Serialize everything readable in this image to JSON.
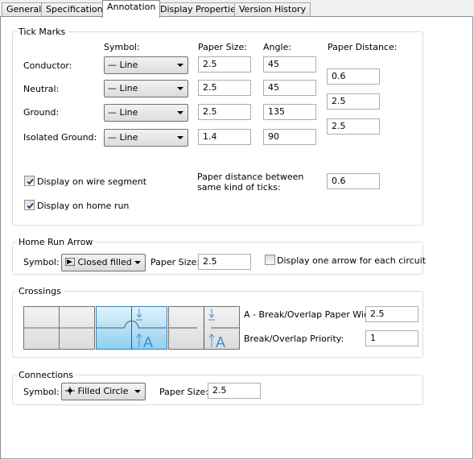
{
  "tabs": [
    "General",
    "Specifications",
    "Annotation",
    "Display Properties",
    "Version History"
  ],
  "tick_marks": {
    "title": "Tick Marks",
    "headers": {
      "symbol": "Symbol:",
      "paper_size": "Paper Size:",
      "angle": "Angle:",
      "paper_distance": "Paper Distance:"
    },
    "rows": [
      {
        "label": "Conductor:",
        "symbol": "Line",
        "paper_size": "2.5",
        "angle": "45"
      },
      {
        "label": "Neutral:",
        "symbol": "Line",
        "paper_size": "2.5",
        "angle": "45"
      },
      {
        "label": "Ground:",
        "symbol": "Line",
        "paper_size": "2.5",
        "angle": "135"
      },
      {
        "label": "Isolated Ground:",
        "symbol": "Line",
        "paper_size": "1.4",
        "angle": "90"
      }
    ],
    "paper_distances": [
      "0.6",
      "2.5",
      "2.5"
    ],
    "display_on_wire_segment": {
      "label": "Display on wire segment",
      "checked": true
    },
    "display_on_home_run": {
      "label": "Display on home run",
      "checked": true
    },
    "same_kind_label": "Paper distance between same kind of ticks:",
    "same_kind_value": "0.6"
  },
  "home_run_arrow": {
    "title": "Home Run Arrow",
    "symbol_label": "Symbol:",
    "symbol_value": "Closed filled",
    "paper_size_label": "Paper Size:",
    "paper_size_value": "2.5",
    "one_arrow_label": "Display one arrow for each circuit",
    "one_arrow_checked": false
  },
  "crossings": {
    "title": "Crossings",
    "selected_style": 2,
    "width_label": "A - Break/Overlap Paper Width:",
    "width_value": "2.5",
    "priority_label": "Break/Overlap Priority:",
    "priority_value": "1",
    "glyph_letter": "A"
  },
  "connections": {
    "title": "Connections",
    "symbol_label": "Symbol:",
    "symbol_value": "Filled Circle",
    "paper_size_label": "Paper Size:",
    "paper_size_value": "2.5"
  },
  "colors": {
    "selected_blue": "#8fd0ef",
    "accent_blue": "#3d8fd6"
  }
}
